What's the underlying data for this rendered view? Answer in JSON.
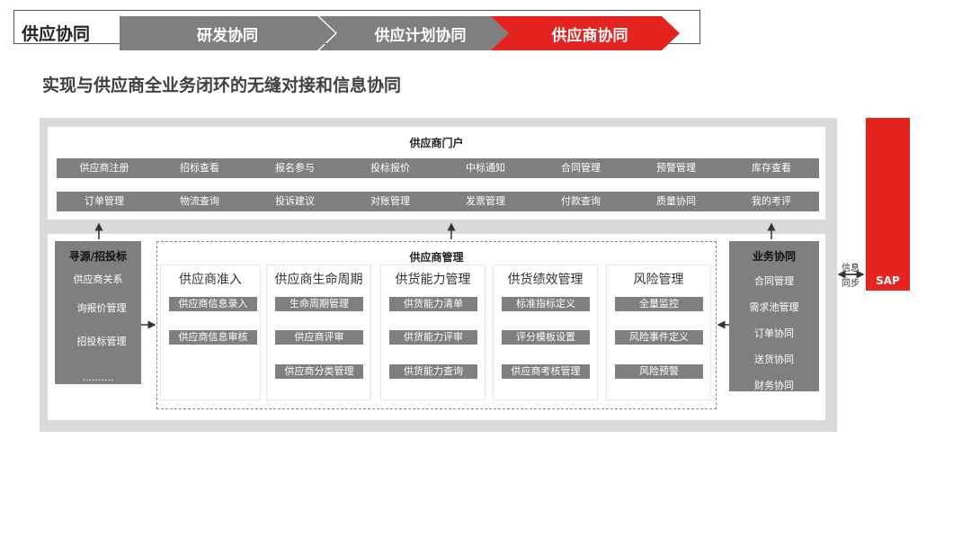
{
  "header": {
    "title": "供应协同",
    "stages": [
      "研发协同",
      "供应计划协同",
      "供应商协同"
    ]
  },
  "subtitle": "实现与供应商全业务闭环的无缝对接和信息协同",
  "portal": {
    "title": "供应商门户",
    "row1": [
      "供应商注册",
      "招标查看",
      "报名参与",
      "投标报价",
      "中标通知",
      "合同管理",
      "预警管理",
      "库存查看"
    ],
    "row2": [
      "订单管理",
      "物流查询",
      "投诉建议",
      "对账管理",
      "发票管理",
      "付款查询",
      "质量协同",
      "我的考评"
    ]
  },
  "sourcing": {
    "title": "寻源/招投标",
    "items": [
      "供应商关系",
      "询报价管理",
      "招投标管理",
      ".........."
    ]
  },
  "management": {
    "title": "供应商管理",
    "columns": [
      {
        "title": "供应商准入",
        "items": [
          "供应商信息录入",
          "供应商信息审核"
        ]
      },
      {
        "title": "供应商生命周期",
        "items": [
          "生命周期管理",
          "供应商评审",
          "供应商分类管理"
        ]
      },
      {
        "title": "供货能力管理",
        "items": [
          "供货能力清单",
          "供货能力评审",
          "供货能力查询"
        ]
      },
      {
        "title": "供货绩效管理",
        "items": [
          "标准指标定义",
          "评分模板设置",
          "供应商考核管理"
        ]
      },
      {
        "title": "风险管理",
        "items": [
          "全量监控",
          "风险事件定义",
          "风险预警"
        ]
      }
    ]
  },
  "business": {
    "title": "业务协同",
    "items": [
      "合同管理",
      "需求池管理",
      "订单协同",
      "送货协同",
      "财务协同"
    ]
  },
  "sync": {
    "line1": "信息",
    "line2": "同步"
  },
  "sap": "SAP",
  "colors": {
    "gray": "#7f7f7f",
    "red": "#e52420",
    "frame": "#d9d9d9"
  }
}
